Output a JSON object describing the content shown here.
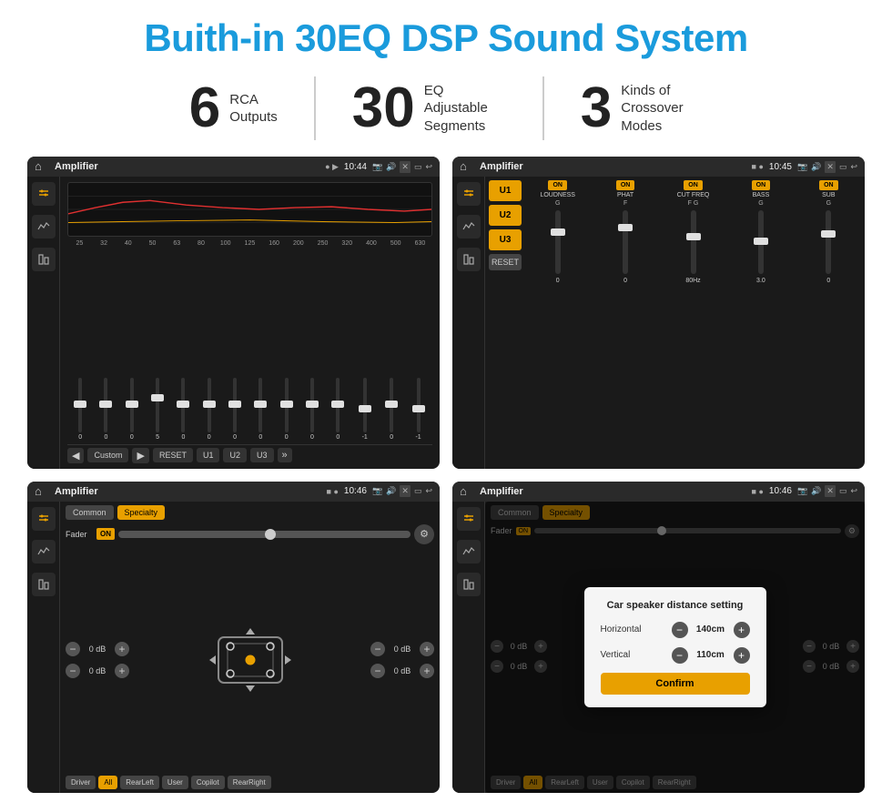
{
  "header": {
    "title": "Buith-in 30EQ DSP Sound System",
    "title_color": "#1a9bdc"
  },
  "stats": [
    {
      "number": "6",
      "desc_line1": "RCA",
      "desc_line2": "Outputs"
    },
    {
      "number": "30",
      "desc_line1": "EQ Adjustable",
      "desc_line2": "Segments"
    },
    {
      "number": "3",
      "desc_line1": "Kinds of",
      "desc_line2": "Crossover Modes"
    }
  ],
  "screens": {
    "eq": {
      "title": "Amplifier",
      "time": "10:44",
      "freq_labels": [
        "25",
        "32",
        "40",
        "50",
        "63",
        "80",
        "100",
        "125",
        "160",
        "200",
        "250",
        "320",
        "400",
        "500",
        "630"
      ],
      "slider_values": [
        "0",
        "0",
        "0",
        "5",
        "0",
        "0",
        "0",
        "0",
        "0",
        "0",
        "0",
        "-1",
        "0",
        "-1"
      ],
      "bottom_btns": [
        "Custom",
        "RESET",
        "U1",
        "U2",
        "U3"
      ]
    },
    "crossover": {
      "title": "Amplifier",
      "time": "10:45",
      "u_btns": [
        "U1",
        "U2",
        "U3"
      ],
      "channels": [
        "LOUDNESS",
        "PHAT",
        "CUT FREQ",
        "BASS",
        "SUB"
      ],
      "reset_label": "RESET"
    },
    "fader": {
      "title": "Amplifier",
      "time": "10:46",
      "tabs": [
        "Common",
        "Specialty"
      ],
      "fader_label": "Fader",
      "on_label": "ON",
      "db_values": [
        "0 dB",
        "0 dB",
        "0 dB",
        "0 dB"
      ],
      "bottom_btns": [
        "Driver",
        "Copilot",
        "RearLeft",
        "All",
        "User",
        "RearRight"
      ]
    },
    "distance": {
      "title": "Amplifier",
      "time": "10:46",
      "tabs": [
        "Common",
        "Specialty"
      ],
      "dialog": {
        "title": "Car speaker distance setting",
        "horizontal_label": "Horizontal",
        "horizontal_val": "140cm",
        "vertical_label": "Vertical",
        "vertical_val": "110cm",
        "confirm_label": "Confirm"
      },
      "db_values": [
        "0 dB",
        "0 dB"
      ],
      "bottom_btns": [
        "Driver",
        "Copilot",
        "RearLeft",
        "All",
        "User",
        "RearRight"
      ]
    }
  }
}
